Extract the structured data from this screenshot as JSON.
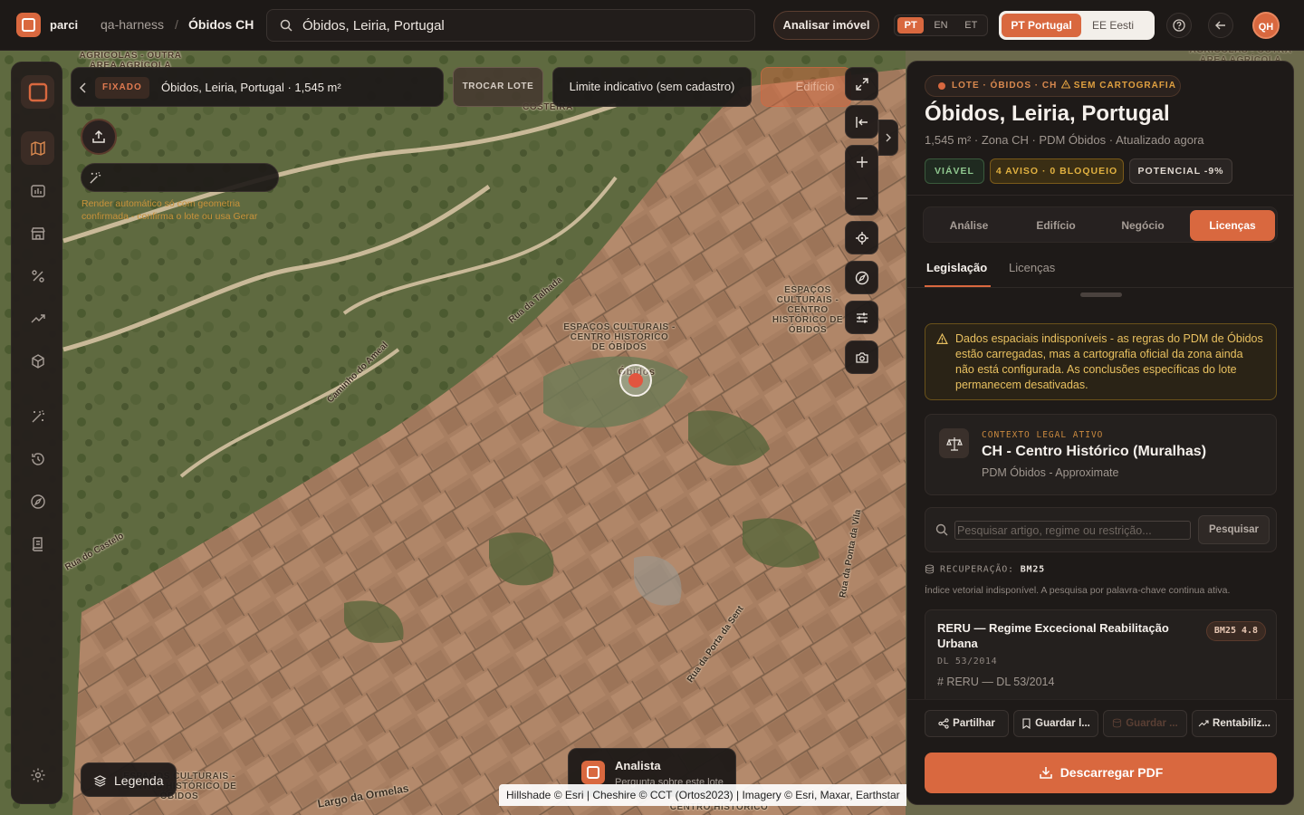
{
  "topbar": {
    "brand": "parci",
    "breadcrumb": [
      "qa-harness",
      "Óbidos CH"
    ],
    "breadcrumb_sep": "/",
    "search_value": "Óbidos, Leiria, Portugal",
    "analyze_label": "Analisar imóvel",
    "languages": [
      "PT",
      "EN",
      "ET"
    ],
    "active_language": "PT",
    "countries": [
      "PT Portugal",
      "EE Eesti"
    ],
    "avatar_initials": "QH"
  },
  "map": {
    "fixed_tag": "FIXADO",
    "fixed_text": "Óbidos, Leiria, Portugal · 1,545 m²",
    "swap_label": "TROCAR LOTE",
    "limit_label": "Limite indicativo (sem cadastro)",
    "building_label": "Edifício",
    "render_note": "Render automático só com geometria confirmada - confirma o lote ou usa Gerar",
    "legend_label": "Legenda",
    "analyst_title": "Analista",
    "analyst_sub": "Pergunta sobre este lote",
    "attribution": "Hillshade © Esri | Cheshire © CCT (Ortos2023) | Imagery © Esri, Maxar, Earthstar",
    "labels": {
      "agricolas_top": "AGRÍCOLAS - OUTRA ÁREA AGRÍCOLA",
      "agricolas_right": "AGRÍCOLAS - OUTRA ÁREA AGRÍCOLA",
      "espacos_center": "ESPAÇOS CULTURAIS - CENTRO HISTÓRICO DE ÓBIDOS",
      "espacos_right": "ESPAÇOS CULTURAIS - CENTRO HISTÓRICO DE ÓBIDOS",
      "espacos_bottom": "ESPAÇOS CULTURAIS - CENTRO HISTÓRICO DE ÓBIDOS",
      "centro_bottom": "CENTRO HISTÓRICO",
      "obidos": "Óbidos",
      "costeira": "COSTEIRA"
    },
    "streets": [
      "Rua do Castelo",
      "Rua da Ponta da Vila",
      "Rua da Porta da Sent",
      "Caminho do Ameal",
      "Rua da Talhada",
      "Largo da Ormelas"
    ],
    "colors": {
      "accent": "#d9683f",
      "warning": "#e0b040",
      "ok": "#8fc78f"
    }
  },
  "panel": {
    "badge": "LOTE · ÓBIDOS · CH",
    "badge_warning": "SEM CARTOGRAFIA",
    "title": "Óbidos, Leiria, Portugal",
    "subtitle": "1,545 m² · Zona CH · PDM Óbidos · Atualizado agora",
    "chips": [
      "VIÁVEL",
      "4 AVISO · 0 BLOQUEIO",
      "POTENCIAL -9%"
    ],
    "tabs": [
      "Análise",
      "Edifício",
      "Negócio",
      "Licenças"
    ],
    "active_tab": "Licenças",
    "subtabs": [
      "Legislação",
      "Licenças"
    ],
    "alert": "Dados espaciais indisponíveis - as regras do PDM de Óbidos estão carregadas, mas a cartografia oficial da zona ainda não está configurada. As conclusões específicas do lote permanecem desativadas.",
    "legal_kicker": "CONTEXTO LEGAL ATIVO",
    "legal_title": "CH - Centro Histórico (Muralhas)",
    "legal_sub": "PDM Óbidos - Approximate",
    "search_placeholder": "Pesquisar artigo, regime ou restrição...",
    "search_button": "Pesquisar",
    "retrieval_label": "RECUPERAÇÃO:",
    "retrieval_value": "BM25",
    "retrieval_note": "Índice vetorial indisponível. A pesquisa por palavra-chave continua ativa.",
    "result": {
      "title": "RERU — Regime Excecional Reabilitação Urbana",
      "score": "BM25 4.8",
      "ref": "DL 53/2014",
      "tag": "# RERU — DL 53/2014"
    },
    "actions": [
      "Partilhar",
      "Guardar l...",
      "Guardar ...",
      "Rentabiliz..."
    ],
    "pdf_label": "Descarregar PDF"
  }
}
